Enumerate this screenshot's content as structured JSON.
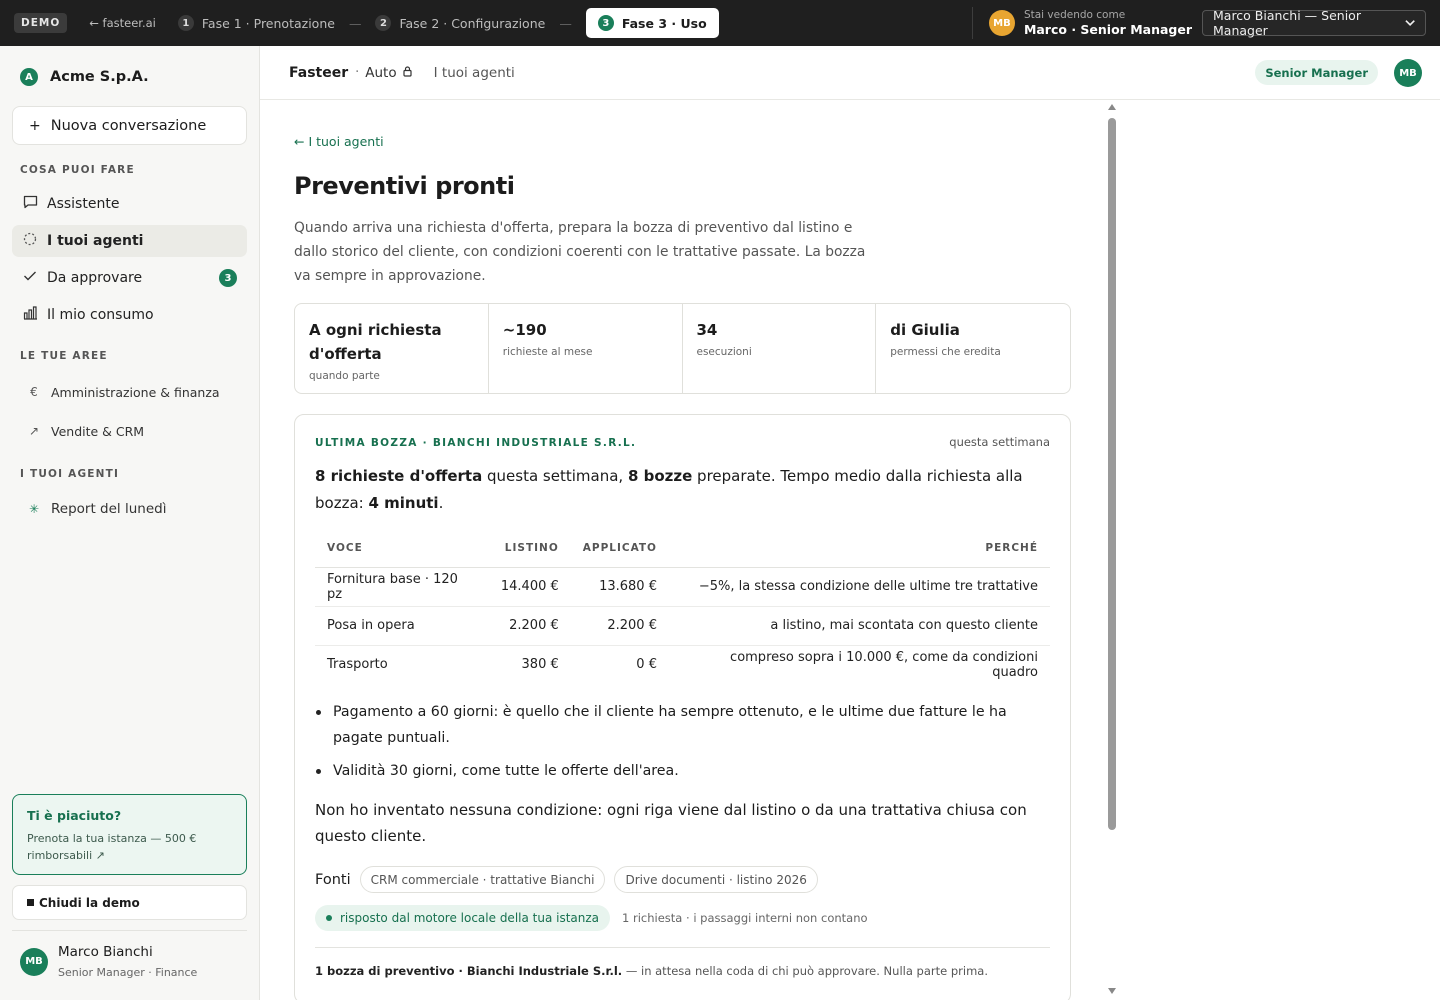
{
  "topbar": {
    "demo_badge": "DEMO",
    "back_link": "← fasteer.ai",
    "phases": [
      {
        "num": "1",
        "label": "Fase 1 · Prenotazione"
      },
      {
        "num": "2",
        "label": "Fase 2 · Configurazione"
      },
      {
        "num": "3",
        "label": "Fase 3 · Uso"
      }
    ],
    "separator": "—",
    "viewer_avatar": "MB",
    "viewer_caption": "Stai vedendo come",
    "viewer_name": "Marco · Senior Manager",
    "viewer_select": "Marco Bianchi — Senior Manager"
  },
  "sidebar": {
    "org_logo": "A",
    "org_name": "Acme S.p.A.",
    "new_conversation": "Nuova conversazione",
    "heading_can_do": "COSA PUOI FARE",
    "nav": [
      {
        "label": "Assistente",
        "icon": "chat-icon"
      },
      {
        "label": "I tuoi agenti",
        "icon": "agents-icon"
      },
      {
        "label": "Da approvare",
        "icon": "check-icon",
        "badge": "3"
      },
      {
        "label": "Il mio consumo",
        "icon": "chart-icon"
      }
    ],
    "heading_areas": "LE TUE AREE",
    "areas": [
      {
        "label": "Amministrazione & finanza",
        "icon": "euro-icon"
      },
      {
        "label": "Vendite & CRM",
        "icon": "trend-icon"
      }
    ],
    "heading_agents": "I TUOI AGENTI",
    "agents": [
      {
        "label": "Report del lunedì",
        "icon": "sparkle-icon"
      }
    ],
    "promo_title": "Ti è piaciuto?",
    "promo_text": "Prenota la tua istanza — 500 € rimborsabili ↗",
    "close_demo": "Chiudi la demo",
    "user_avatar": "MB",
    "user_name": "Marco Bianchi",
    "user_role": "Senior Manager · Finance"
  },
  "header": {
    "brand": "Fasteer",
    "dot": "·",
    "mode": "Auto",
    "link": "I tuoi agenti",
    "role_pill": "Senior Manager",
    "avatar": "MB"
  },
  "main": {
    "back_link": "← I tuoi agenti",
    "title": "Preventivi pronti",
    "description": "Quando arriva una richiesta d'offerta, prepara la bozza di preventivo dal listino e dallo storico del cliente, con condizioni coerenti con le trattative passate. La bozza va sempre in approvazione.",
    "stats": [
      {
        "value": "A ogni richiesta d'offerta",
        "label": "quando parte"
      },
      {
        "value": "~190",
        "label": "richieste al mese"
      },
      {
        "value": "34",
        "label": "esecuzioni"
      },
      {
        "value": "di Giulia",
        "label": "permessi che eredita"
      }
    ],
    "card": {
      "eyebrow": "ULTIMA BOZZA · BIANCHI INDUSTRIALE S.R.L.",
      "when": "questa settimana",
      "lead_b1": "8 richieste d'offerta",
      "lead_t1": " questa settimana, ",
      "lead_b2": "8 bozze",
      "lead_t2": " preparate. Tempo medio dalla richiesta alla bozza: ",
      "lead_b3": "4 minuti",
      "lead_t3": ".",
      "table_headers": {
        "voce": "VOCE",
        "listino": "LISTINO",
        "applicato": "APPLICATO",
        "perche": "PERCHÉ"
      },
      "rows": [
        {
          "voce": "Fornitura base · 120 pz",
          "listino": "14.400 €",
          "applicato": "13.680 €",
          "perche": "−5%, la stessa condizione delle ultime tre trattative"
        },
        {
          "voce": "Posa in opera",
          "listino": "2.200 €",
          "applicato": "2.200 €",
          "perche": "a listino, mai scontata con questo cliente"
        },
        {
          "voce": "Trasporto",
          "listino": "380 €",
          "applicato": "0 €",
          "perche": "compreso sopra i 10.000 €, come da condizioni quadro"
        }
      ],
      "bullets": [
        "Pagamento a 60 giorni: è quello che il cliente ha sempre ottenuto, e le ultime due fatture le ha pagate puntuali.",
        "Validità 30 giorni, come tutte le offerte dell'area."
      ],
      "closing": "Non ho inventato nessuna condizione: ogni riga viene dal listino o da una trattativa chiusa con questo cliente.",
      "sources_label": "Fonti",
      "sources": [
        "CRM commerciale · trattative Bianchi",
        "Drive documenti · listino 2026"
      ],
      "engine_pill": "risposto dal motore locale della tua istanza",
      "engine_note": "1 richiesta · i passaggi interni non contano",
      "foot_bold": "1 bozza di preventivo · Bianchi Industriale S.r.l.",
      "foot_text": " — in attesa nella coda di chi può approvare. Nulla parte prima."
    }
  },
  "colors": {
    "accent": "#1a7f5a",
    "topbar": "#1f1f1f",
    "viewer_avatar": "#e8a531"
  }
}
